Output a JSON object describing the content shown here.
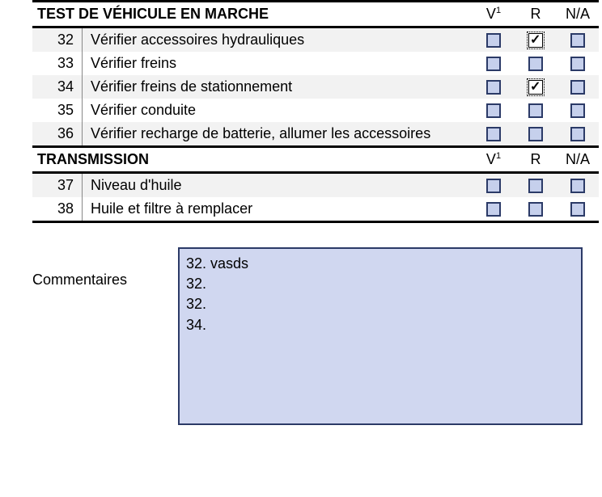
{
  "sections": [
    {
      "title": "TEST DE VÉHICULE EN MARCHE",
      "columns": {
        "v": "V",
        "vsup": "1",
        "r": "R",
        "na": "N/A"
      },
      "items": [
        {
          "num": "32",
          "desc": "Vérifier accessoires hydrauliques",
          "v": false,
          "r": true,
          "na": false
        },
        {
          "num": "33",
          "desc": "Vérifier freins",
          "v": false,
          "r": false,
          "na": false
        },
        {
          "num": "34",
          "desc": "Vérifier freins de stationnement",
          "v": false,
          "r": true,
          "na": false
        },
        {
          "num": "35",
          "desc": "Vérifier conduite",
          "v": false,
          "r": false,
          "na": false
        },
        {
          "num": "36",
          "desc": "Vérifier recharge de batterie, allumer les accessoires",
          "v": false,
          "r": false,
          "na": false
        }
      ]
    },
    {
      "title": "TRANSMISSION",
      "columns": {
        "v": "V",
        "vsup": "1",
        "r": "R",
        "na": "N/A"
      },
      "items": [
        {
          "num": "37",
          "desc": "Niveau d'huile",
          "v": false,
          "r": false,
          "na": false
        },
        {
          "num": "38",
          "desc": "Huile et filtre à remplacer",
          "v": false,
          "r": false,
          "na": false
        }
      ]
    }
  ],
  "comments": {
    "label": "Commentaires",
    "text": "32. vasds\n32.\n32.\n34."
  }
}
